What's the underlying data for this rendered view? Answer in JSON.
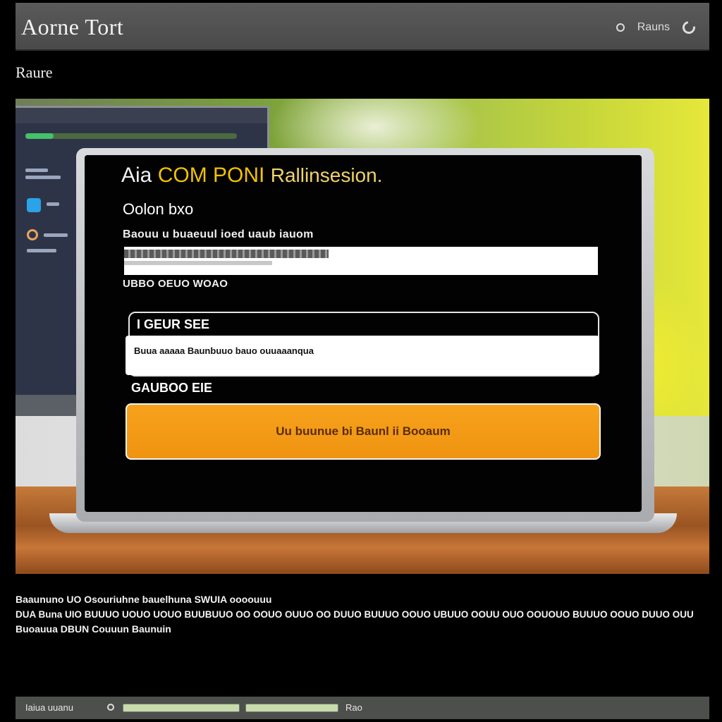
{
  "window": {
    "title": "Aorne Tort",
    "top_link": "Rauns",
    "page_label": "Raure"
  },
  "dialog": {
    "heading_prefix": "Aia",
    "heading_highlight": "COM PONI",
    "heading_suffix": "Rallinsesion.",
    "subheading": "Oolon bxo",
    "field1_label": "Baouu u buaeuul ioed uaub iauom",
    "field1_placeholder": "",
    "field1_hint": "UBBO OEUO WOAO",
    "group_label": "I GEUR SEE",
    "field2_value": "Buua aaaaa Baunbuuo bauo ouuaaanqua",
    "secondary_link": "GAUBOO EIE",
    "primary_button": "Uu buunue bi Baunl ii Booaum"
  },
  "description": {
    "line1": "Baaununo UO Osouriuhne bauelhuna SWUIA oooouuu",
    "line2": "DUA Buna UIO BUUUO UOUO UOUO BUUBUUO OO OOUO OUUO OO DUUO BUUUO OOUO UBUUO OOUU OUO OOUOUO BUUUO OOUO DUUO OUU",
    "line3": "Buoauua DBUN Couuun Baunuin"
  },
  "statusbar": {
    "label": "Iaiua uuanu",
    "progress1": 1.0,
    "progress2": 1.0,
    "right_label": "Rao"
  },
  "colors": {
    "accent": "#f2c200",
    "button": "#f7a21d"
  }
}
